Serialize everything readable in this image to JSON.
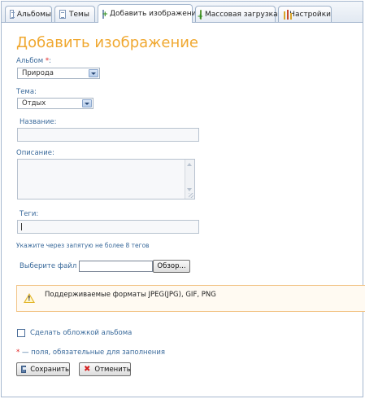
{
  "tabs": [
    {
      "label": "Альбомы",
      "icon": "document-icon"
    },
    {
      "label": "Темы",
      "icon": "document-icon"
    },
    {
      "label": "Добавить изображение",
      "icon": "add-image-icon"
    },
    {
      "label": "Массовая загрузка",
      "icon": "mass-upload-icon"
    },
    {
      "label": "Настройки",
      "icon": "settings-icon"
    }
  ],
  "active_tab": "Добавить изображение",
  "page_title": "Добавить изображение",
  "form": {
    "album_label": "Альбом",
    "required_mark": "*",
    "label_colon": ":",
    "album_value": "Природа",
    "theme_label": "Тема:",
    "theme_value": "Отдых",
    "name_label": "Название:",
    "name_value": "",
    "description_label": "Описание:",
    "description_value": "",
    "tags_label": "Теги:",
    "tags_value": "",
    "tags_hint": "Укажите через запятую не более 8 тегов",
    "file_label": "Выберите файл",
    "browse_button": "Обзор...",
    "formats_notice": "Поддерживаемые форматы JPEG(JPG), GIF, PNG",
    "cover_checkbox_label": "Сделать обложкой альбома",
    "cover_checked": false,
    "required_note": "— поля, обязательные для заполнения",
    "save_button": "Сохранить",
    "cancel_button": "Отменить"
  },
  "colors": {
    "title": "#f0a830",
    "label": "#3a6a9b",
    "required": "#e02020",
    "notice_border": "#f2c487",
    "warning_icon": "#e3b52b"
  }
}
